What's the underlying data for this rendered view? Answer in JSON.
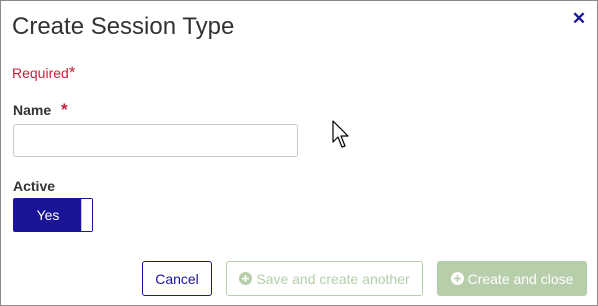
{
  "dialog": {
    "title": "Create Session Type",
    "close_glyph": "✕"
  },
  "form": {
    "required_note": "Required",
    "required_marker": "*",
    "name_label": "Name",
    "name_value": "",
    "name_placeholder": "",
    "active_label": "Active",
    "active_toggle_label": "Yes",
    "active_state": "on"
  },
  "buttons": {
    "cancel": "Cancel",
    "save_and_create_another": "Save and create another",
    "create_and_close": "Create and close"
  },
  "icons": {
    "close": "close-icon",
    "plus_circle": "plus-circle-icon",
    "cursor": "mouse-pointer-icon"
  },
  "colors": {
    "accent": "#1a1496",
    "required": "#c5223a",
    "disabled_green": "#b7ceaa",
    "text": "#333333"
  }
}
